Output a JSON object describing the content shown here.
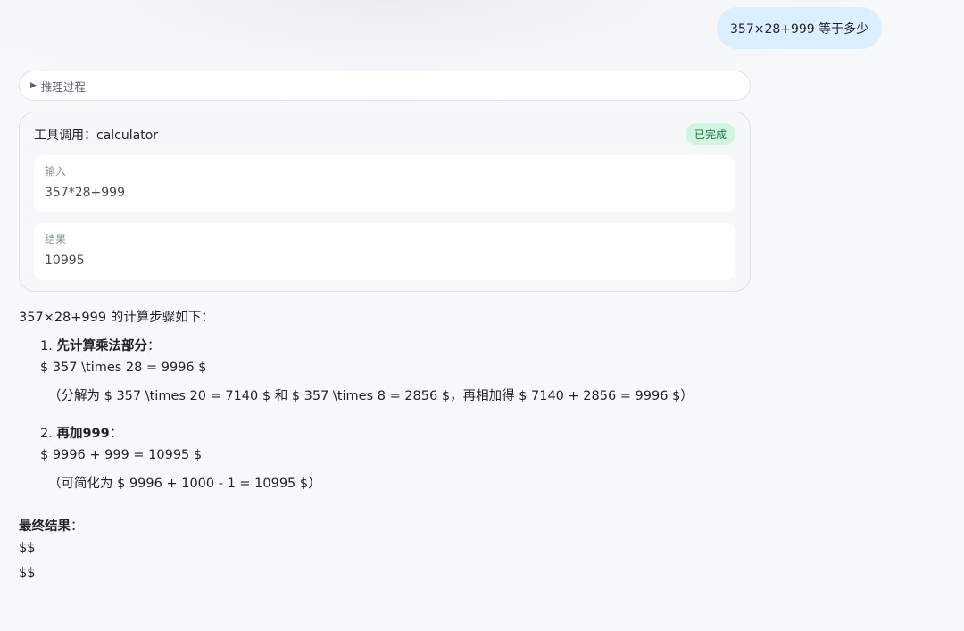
{
  "user_message": "357×28+999 等于多少",
  "reasoning": {
    "label": "推理过程"
  },
  "tool_call": {
    "title_prefix": "工具调用：",
    "tool_name": "calculator",
    "status": "已完成",
    "input_label": "输入",
    "input_value": "357*28+999",
    "result_label": "结果",
    "result_value": "10995"
  },
  "answer": {
    "intro": "357×28+999 的计算步骤如下：",
    "step1": {
      "number": "1.",
      "title": "先计算乘法部分",
      "colon": "：",
      "formula": "$ 357 \\times 28 = 9996 $",
      "note": "（分解为 $ 357 \\times 20 = 7140 $ 和 $ 357 \\times 8 = 2856 $，再相加得 $ 7140 + 2856 = 9996 $）"
    },
    "step2": {
      "number": "2.",
      "title": "再加999",
      "colon": "：",
      "formula": "$ 9996 + 999 = 10995 $",
      "note": "（可简化为 $ 9996 + 1000 - 1 = 10995 $）"
    },
    "final_label": "最终结果",
    "final_colon": "：",
    "final_line1": "$$",
    "final_line2": "$$"
  }
}
